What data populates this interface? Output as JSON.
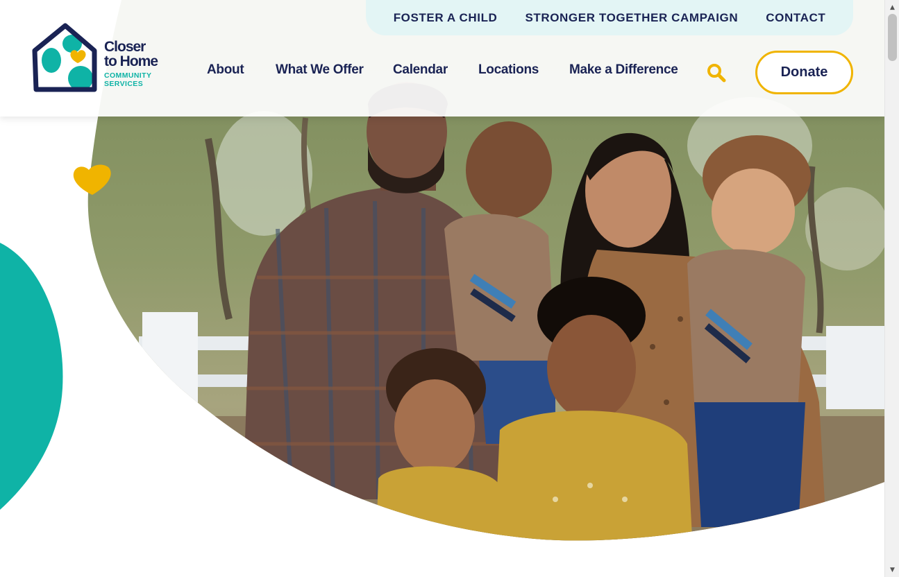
{
  "logo": {
    "line1": "Closer",
    "line2": "to Home",
    "line3": "COMMUNITY",
    "line4": "SERVICES"
  },
  "utility_nav": [
    {
      "label": "FOSTER A CHILD"
    },
    {
      "label": "STRONGER TOGETHER CAMPAIGN"
    },
    {
      "label": "CONTACT"
    }
  ],
  "main_nav": [
    {
      "label": "About"
    },
    {
      "label": "What We Offer"
    },
    {
      "label": "Calendar"
    },
    {
      "label": "Locations"
    },
    {
      "label": "Make a Difference"
    }
  ],
  "donate": {
    "label": "Donate"
  },
  "icons": {
    "search": "search-icon",
    "heart": "heart-icon",
    "scroll_up": "scroll-up-arrow-icon",
    "scroll_down": "scroll-down-arrow-icon"
  },
  "colors": {
    "navy": "#1a2354",
    "teal": "#0fb3a6",
    "gold": "#f0b400",
    "utility_bar_bg": "#e3f5f5"
  },
  "hero": {
    "image": "family-photo"
  }
}
